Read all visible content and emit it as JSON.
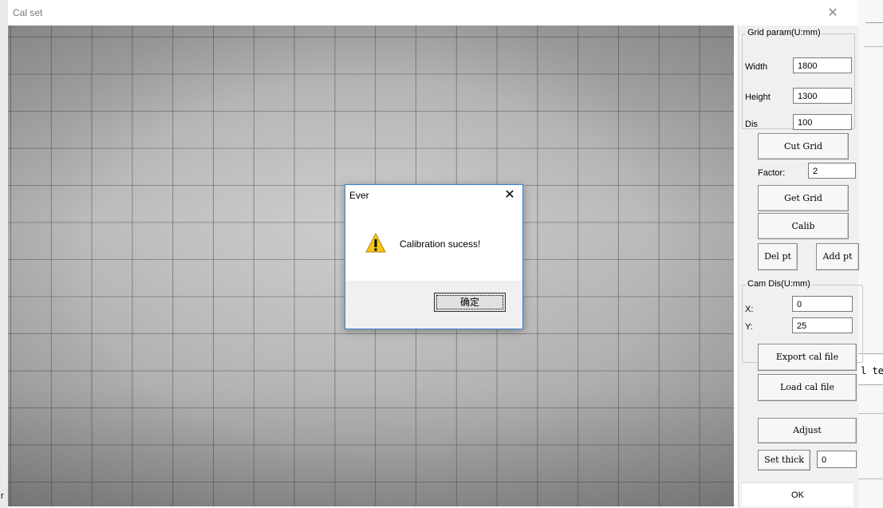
{
  "window": {
    "title": "Cal set",
    "close_glyph": "✕"
  },
  "background": {
    "fragment_text": "l tes",
    "left_letter": "r"
  },
  "panel": {
    "grid_param": {
      "label": "Grid param(U:mm)",
      "width_label": "Width",
      "width_value": "1800",
      "height_label": "Height",
      "height_value": "1300",
      "dis_label": "Dis",
      "dis_value": "100"
    },
    "cut_grid": "Cut Grid",
    "factor_label": "Factor:",
    "factor_value": "2",
    "get_grid": "Get Grid",
    "calib": "Calib",
    "del_pt": "Del pt",
    "add_pt": "Add pt",
    "cam_dis": {
      "label": "Cam Dis(U:mm)",
      "x_label": "X:",
      "x_value": "0",
      "y_label": "Y:",
      "y_value": "25"
    },
    "export_cal": "Export cal file",
    "load_cal": "Load cal file",
    "adjust": "Adjust",
    "set_thick": "Set thick",
    "thick_value": "0",
    "ok": "OK"
  },
  "dialog": {
    "title": "Ever",
    "close_glyph": "✕",
    "icon": "warning-icon",
    "message": "Calibration sucess!",
    "ok_label": "确定"
  },
  "colors": {
    "dialog_border": "#3c7fd1",
    "warning_fill": "#f5c518"
  }
}
